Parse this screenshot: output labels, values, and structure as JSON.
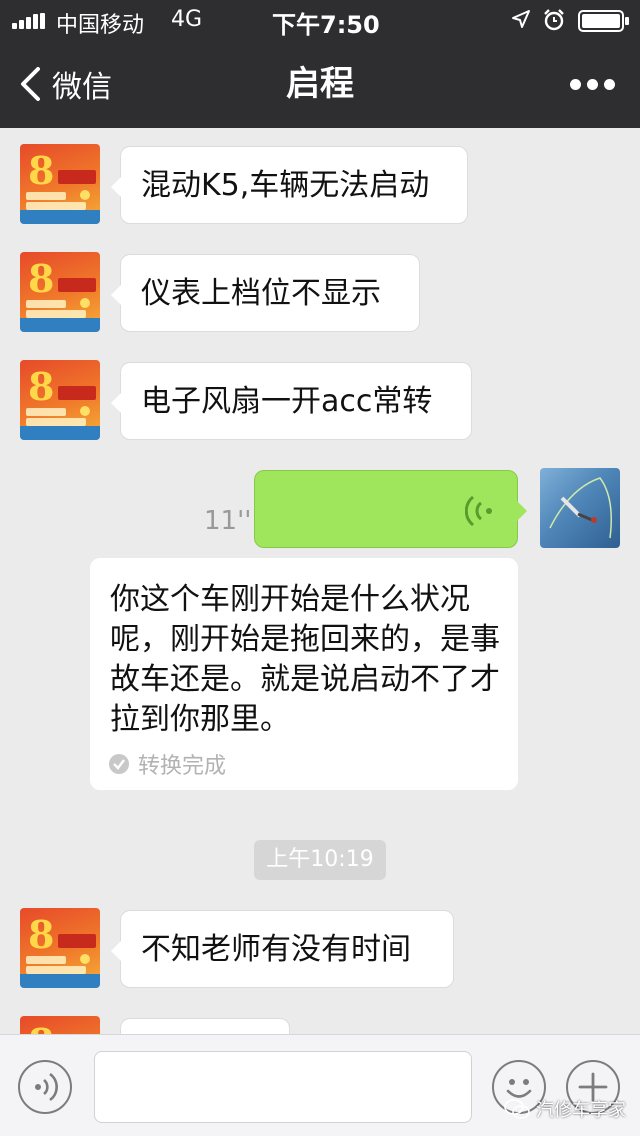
{
  "status_bar": {
    "carrier": "中国移动",
    "network": "4G",
    "time": "下午7:50"
  },
  "nav": {
    "back_label": "微信",
    "title": "启程"
  },
  "messages": [
    {
      "sender": "other",
      "text": "混动K5,车辆无法启动"
    },
    {
      "sender": "other",
      "text": "仪表上档位不显示"
    },
    {
      "sender": "other",
      "text": "电子风扇一开acc常转"
    },
    {
      "sender": "me",
      "type": "voice",
      "duration": "11''"
    },
    {
      "sender": "me",
      "type": "transcript",
      "text": "你这个车刚开始是什么状况呢，刚开始是拖回来的，是事故车还是。就是说启动不了才拉到你那里。",
      "status": "转换完成"
    },
    {
      "type": "time_divider",
      "text": "上午10:19"
    },
    {
      "sender": "other",
      "text": "不知老师有没有时间"
    }
  ],
  "input_bar": {
    "value": ""
  },
  "watermark": "汽修车享家",
  "colors": {
    "header_bg": "#2e2e30",
    "chat_bg": "#ebebeb",
    "bubble_out": "#a0e65c",
    "bubble_in": "#ffffff"
  }
}
